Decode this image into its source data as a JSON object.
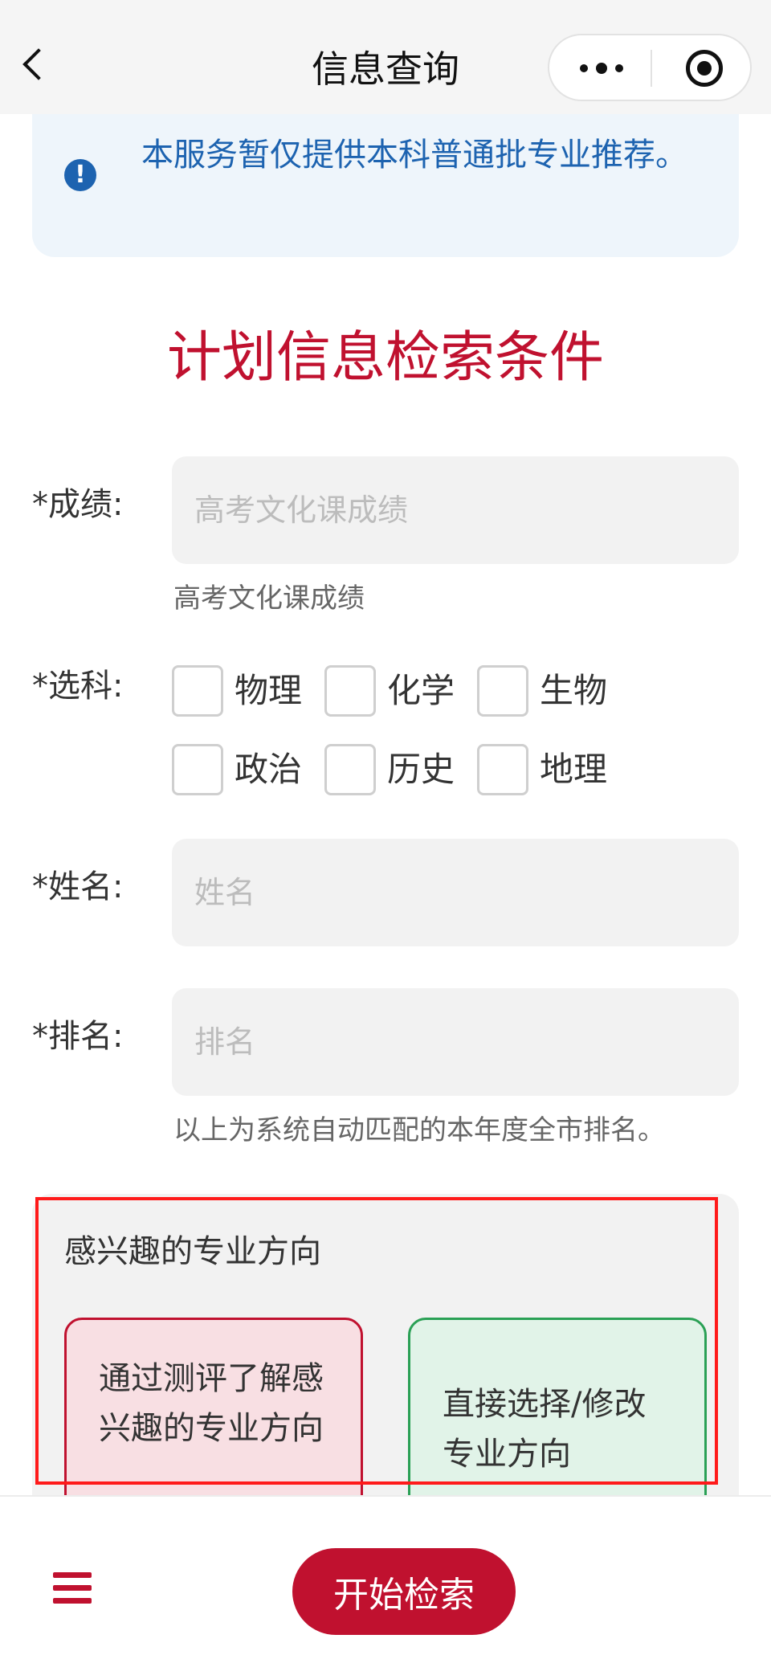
{
  "navbar": {
    "title": "信息查询"
  },
  "notice": {
    "text": "本服务暂仅提供本科普通批专业推荐。"
  },
  "section_title": "计划信息检索条件",
  "form": {
    "score": {
      "label": "*成绩:",
      "placeholder": "高考文化课成绩",
      "hint": "高考文化课成绩"
    },
    "subjects": {
      "label": "*选科:",
      "options": [
        "物理",
        "化学",
        "生物",
        "政治",
        "历史",
        "地理"
      ]
    },
    "name": {
      "label": "*姓名:",
      "placeholder": "姓名"
    },
    "rank": {
      "label": "*排名:",
      "placeholder": "排名",
      "hint": "以上为系统自动匹配的本年度全市排名。"
    }
  },
  "interest": {
    "title": "感兴趣的专业方向",
    "option_test": "通过测评了解感兴趣的专业方向",
    "option_direct": "直接选择/修改专业方向"
  },
  "bottom": {
    "search_label": "开始检索"
  },
  "colors": {
    "brand_red": "#c0112f",
    "info_blue": "#1d63b0",
    "green": "#2aa055",
    "highlight": "#ff1a1a"
  },
  "icons": [
    "back-icon",
    "more-icon",
    "target-icon",
    "info-icon",
    "menu-icon"
  ]
}
